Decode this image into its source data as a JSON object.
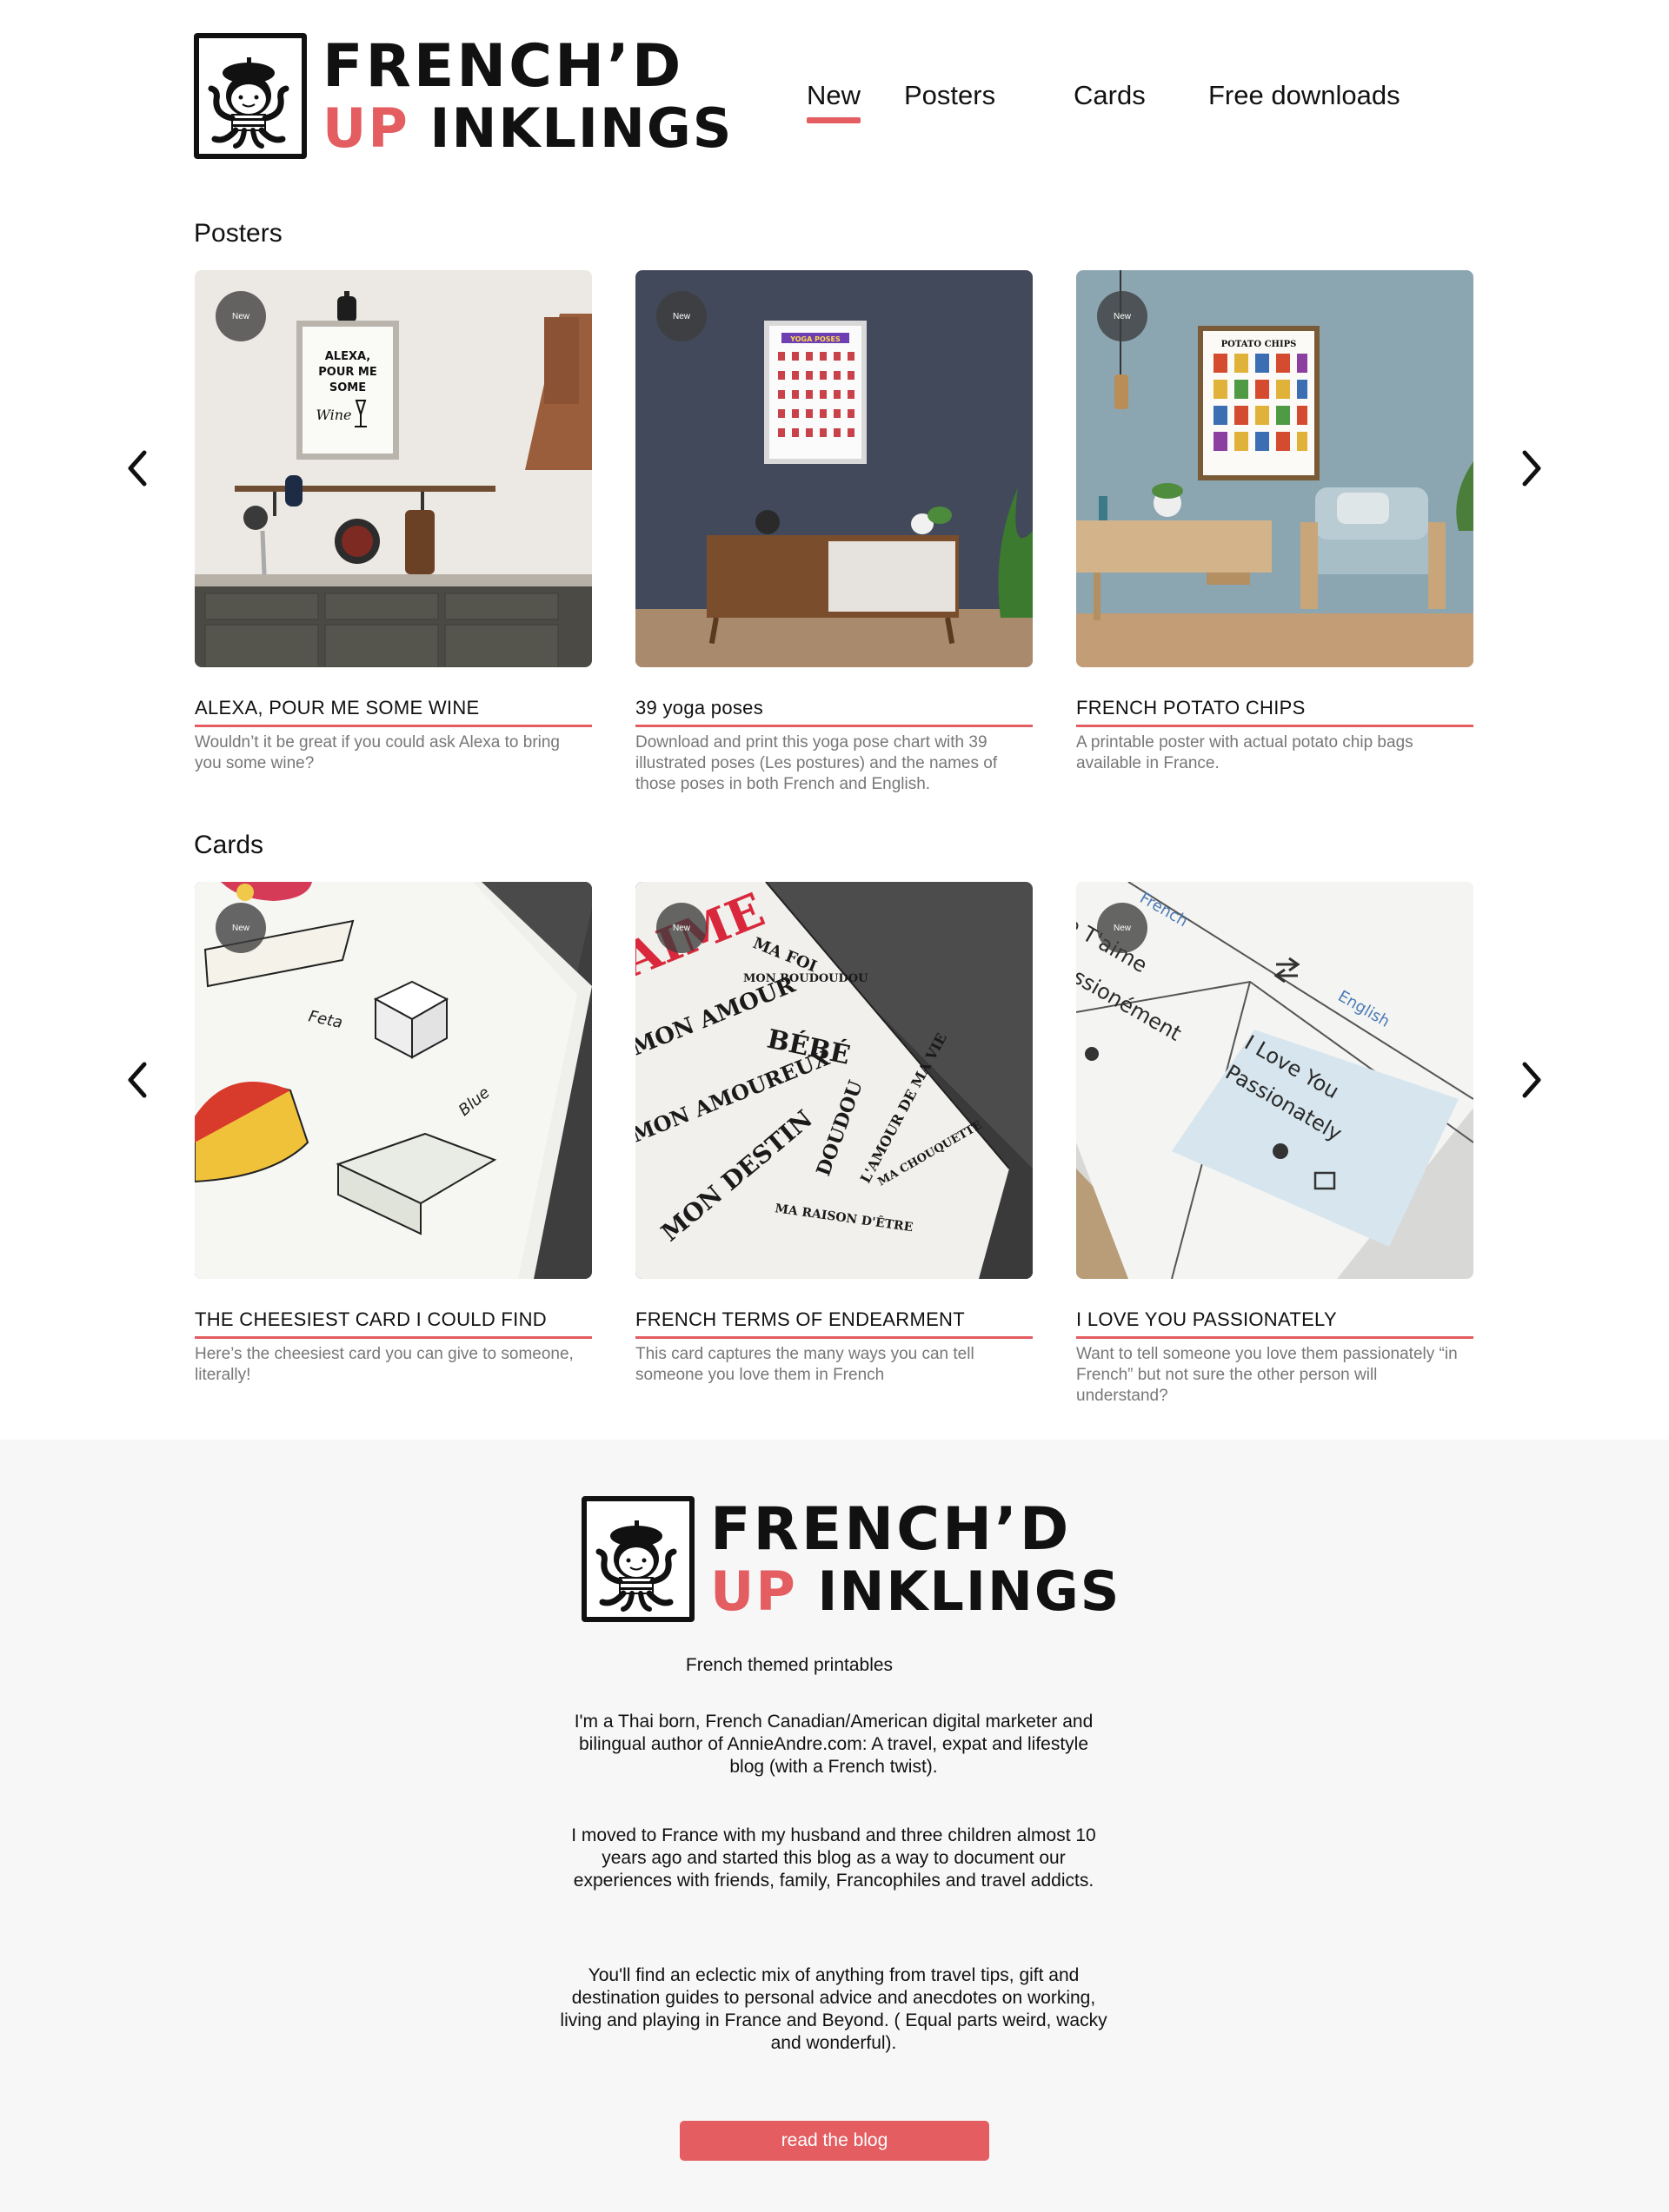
{
  "brand": {
    "line1": "FRENCH’D",
    "line2_accent": "UP",
    "line2_rest": "INKLINGS"
  },
  "nav": [
    {
      "label": "New",
      "active": true
    },
    {
      "label": "Posters",
      "active": false
    },
    {
      "label": "Cards",
      "active": false
    },
    {
      "label": "Free downloads",
      "active": false
    }
  ],
  "badge_label": "New",
  "posters": {
    "title": "Posters",
    "items": [
      {
        "title": "ALEXA, POUR ME SOME WINE",
        "desc": "Wouldn’t it be great if you could ask Alexa to bring you some wine?",
        "art_text": [
          "ALEXA,",
          "POUR ME",
          "SOME",
          "Wine"
        ]
      },
      {
        "title": "39 yoga poses",
        "desc": "Download and print this yoga pose chart with 39 illustrated poses (Les postures) and the names of those poses in both French and English.",
        "art_text": [
          "YOGA POSES"
        ]
      },
      {
        "title": "FRENCH POTATO CHIPS",
        "desc": "A printable poster with actual potato chip bags available in France.",
        "art_text": [
          "POTATO CHIPS"
        ]
      }
    ]
  },
  "cards": {
    "title": "Cards",
    "items": [
      {
        "title": "THE CHEESIEST CARD I COULD FIND",
        "desc": "Here’s the cheesiest card you can give to someone, literally!",
        "art_text": [
          "Feta",
          "Blue"
        ]
      },
      {
        "title": "FRENCH TERMS OF ENDEARMENT",
        "desc": "This card captures the many ways you can tell someone you love them in French",
        "art_text": [
          "AIME",
          "MA FOI",
          "MON AMOUR",
          "BÉBÉ",
          "MON AMOUREUX",
          "DOUDOU",
          "MON DESTIN",
          "MA RAISON D'ÊTRE",
          "L'AMOUR DE MA VIE",
          "MA CHOUQUETTE",
          "MON ROUDOUDOU"
        ]
      },
      {
        "title": "I LOVE YOU PASSIONATELY",
        "desc": "Want to tell someone you love them passionately “in French” but not sure the other person will understand?",
        "art_text": [
          "French",
          "English",
          "I Love You",
          "Passionately",
          "Je T'aime",
          "Passionément"
        ]
      }
    ]
  },
  "footer": {
    "tagline": "French themed printables",
    "paragraphs": [
      "I'm a Thai born, French Canadian/American digital marketer and bilingual author of AnnieAndre.com: A travel, expat and lifestyle blog (with a French twist).",
      "I moved to France with my husband and three children almost 10 years ago and started this blog as a way to document our experiences with friends, family, Francophiles and travel addicts.",
      "You'll find an eclectic mix of anything from travel tips, gift and destination guides to personal advice and anecdotes on working, living and playing in France and Beyond. ( Equal parts weird, wacky and wonderful)."
    ],
    "button_label": "read the blog"
  },
  "colors": {
    "accent": "#e35d61",
    "footer_bg": "#f7f7f7",
    "text": "#111111",
    "muted": "#777777"
  },
  "icons": {
    "logo": "octopus-beret-icon",
    "prev": "chevron-left-icon",
    "next": "chevron-right-icon"
  }
}
